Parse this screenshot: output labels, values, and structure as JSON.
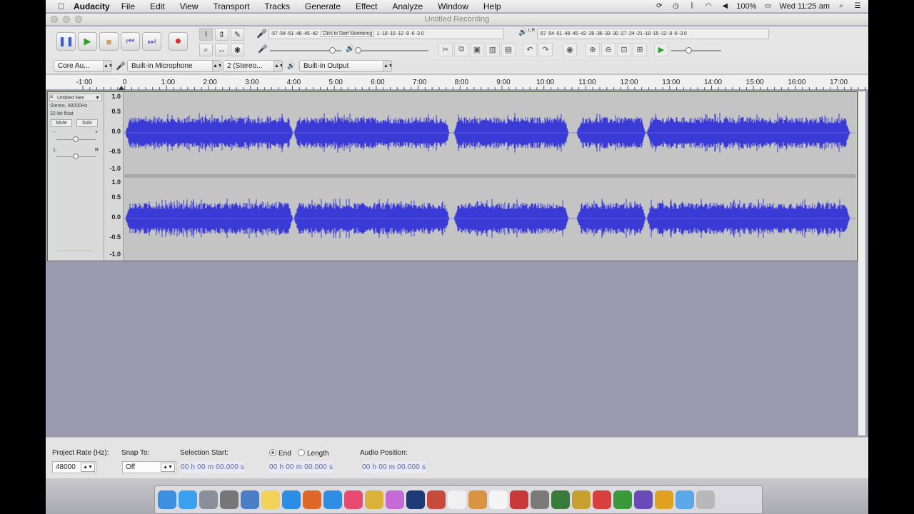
{
  "menubar": {
    "apple": "",
    "app": "Audacity",
    "items": [
      "File",
      "Edit",
      "View",
      "Transport",
      "Tracks",
      "Generate",
      "Effect",
      "Analyze",
      "Window",
      "Help"
    ],
    "battery": "100%",
    "clock": "Wed 11:25 am"
  },
  "window": {
    "title": "Untitled Recording"
  },
  "transport": {
    "pause": "❚❚",
    "play": "▶",
    "stop": "■",
    "skip_start": "⏮",
    "skip_end": "⏭",
    "record": "●"
  },
  "meters": {
    "record_scale": "-57 -54 -51 -48 -45 -42",
    "record_prompt": "Click to Start Monitoring",
    "record_scale2": "1 -18 -15 -12 -9 -6 -3 0",
    "play_label": "L R",
    "play_scale": "-57 -54 -51 -48 -45 -42 -39 -36 -33 -30 -27 -24 -21 -18 -15 -12 -9 -6 -3 0"
  },
  "devices": {
    "host": "Core Au...",
    "input_device": "Built-in Microphone",
    "channels": "2 (Stereo...",
    "output_device": "Built-in Output"
  },
  "ruler": {
    "labels": [
      "-1:00",
      "0",
      "1:00",
      "2:00",
      "3:00",
      "4:00",
      "5:00",
      "6:00",
      "7:00",
      "8:00",
      "9:00",
      "10:00",
      "11:00",
      "12:00",
      "13:00",
      "14:00",
      "15:00",
      "16:00",
      "17:00"
    ]
  },
  "track": {
    "name": "Untitled Rec",
    "rate": "Stereo, 48000Hz",
    "format": "32-bit float",
    "mute": "Mute",
    "solo": "Solo",
    "gain_minus": "-",
    "gain_plus": "+",
    "pan_l": "L",
    "pan_r": "R",
    "scale": [
      "1.0",
      "0.5",
      "0.0",
      "-0.5",
      "-1.0"
    ],
    "wave_color": "#3a3ad6"
  },
  "bottom": {
    "rate_label": "Project Rate (Hz):",
    "rate_value": "48000",
    "snap_label": "Snap To:",
    "snap_value": "Off",
    "sel_start_label": "Selection Start:",
    "end_label": "End",
    "length_label": "Length",
    "audio_pos_label": "Audio Position:",
    "time_value": "00 h 00 m 00.000 s"
  },
  "dock": {
    "apps": [
      "Finder",
      "Safari",
      "Launchpad",
      "System Preferences",
      "Preview",
      "Notes",
      "Edge",
      "Firefox",
      "Safari2",
      "iTunes",
      "Chrome",
      "Photos",
      "Photoshop",
      "Parallels",
      "TextEdit",
      "Pages",
      "Reminders",
      "Cheese",
      "Mail",
      "Games",
      "Gigabyte",
      "ZQ",
      "Filezilla",
      "iMovie",
      "Audacity",
      "Folder",
      "Trash"
    ]
  }
}
